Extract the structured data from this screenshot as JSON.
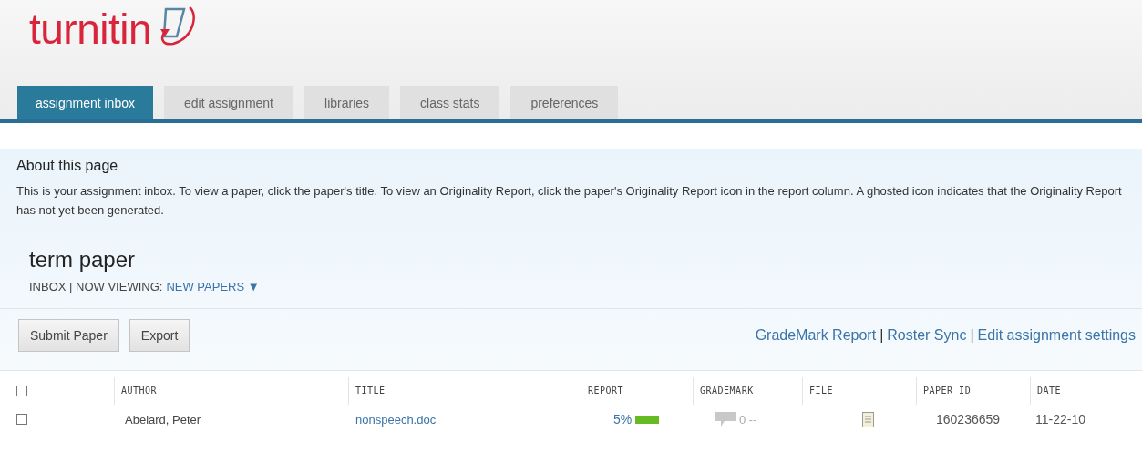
{
  "logo": {
    "text": "turnitin"
  },
  "tabs": [
    {
      "label": "assignment inbox",
      "selected": true
    },
    {
      "label": "edit assignment",
      "selected": false
    },
    {
      "label": "libraries",
      "selected": false
    },
    {
      "label": "class stats",
      "selected": false
    },
    {
      "label": "preferences",
      "selected": false
    }
  ],
  "about": {
    "heading": "About this page",
    "text": "This is your assignment inbox. To view a paper, click the paper's title. To view an Originality Report, click the paper's Originality Report icon in the report column. A ghosted icon indicates that the Originality Report has not yet been generated."
  },
  "assignment": {
    "title": "term paper",
    "inbox": "INBOX | NOW VIEWING:",
    "viewing": "NEW PAPERS ▼"
  },
  "buttons": [
    "Submit Paper",
    "Export"
  ],
  "links": [
    "GradeMark Report",
    "Roster Sync",
    "Edit assignment settings"
  ],
  "link_separator": "|",
  "table": {
    "select_all_checked": false,
    "columns": [
      "AUTHOR",
      "TITLE",
      "REPORT",
      "GRADEMARK",
      "FILE",
      "PAPER ID",
      "DATE"
    ],
    "rows": [
      {
        "checked": false,
        "author": "Abelard, Peter",
        "title": "nonspeech.doc",
        "report": "5%",
        "grademark": "0 --",
        "paper_id": "160236659",
        "date": "11-22-10"
      }
    ]
  }
}
